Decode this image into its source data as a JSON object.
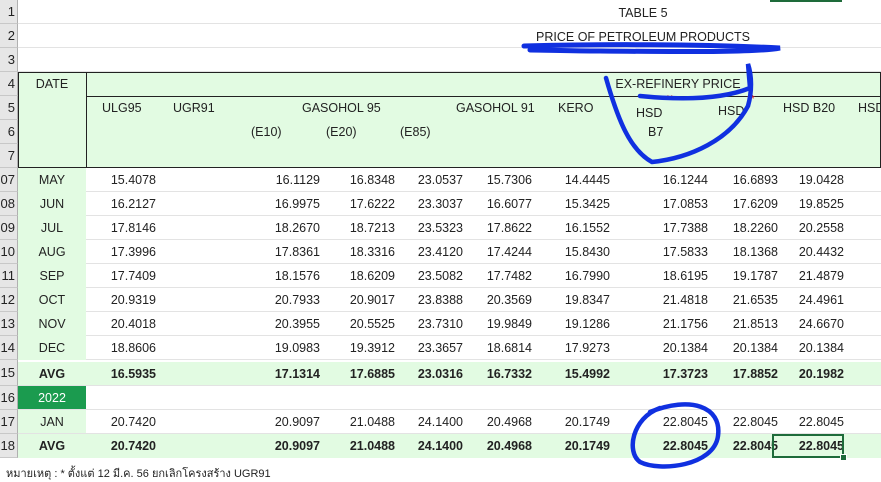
{
  "title": {
    "line1": "TABLE 5",
    "line2": "PRICE OF PETROLEUM PRODUCTS"
  },
  "row_numbers": [
    "1",
    "2",
    "3",
    "4",
    "5",
    "6",
    "7",
    "07",
    "08",
    "09",
    "10",
    "11",
    "12",
    "13",
    "14",
    "15",
    "16",
    "17",
    "18"
  ],
  "header": {
    "date": "DATE",
    "ex_refinery": "EX-REFINERY PRICE",
    "ulg95": "ULG95",
    "ugr91": "UGR91",
    "gasohol95": "GASOHOL 95",
    "e10": "(E10)",
    "e20": "(E20)",
    "e85": "(E85)",
    "gasohol91": "GASOHOL 91",
    "kero": "KERO",
    "hsd": "HSD",
    "b7": "B7",
    "hsd2": "HSD",
    "hsdb20": "HSD B20",
    "hsd_cut": "HSD",
    "marks": "**"
  },
  "rows": [
    {
      "label": "MAY",
      "v": [
        "15.4078",
        "16.1129",
        "16.8348",
        "23.0537",
        "15.7306",
        "14.4445",
        "16.1244",
        "16.6893",
        "19.0428"
      ]
    },
    {
      "label": "JUN",
      "v": [
        "16.2127",
        "16.9975",
        "17.6222",
        "23.3037",
        "16.6077",
        "15.3425",
        "17.0853",
        "17.6209",
        "19.8525"
      ]
    },
    {
      "label": "JUL",
      "v": [
        "17.8146",
        "18.2670",
        "18.7213",
        "23.5323",
        "17.8622",
        "16.1552",
        "17.7388",
        "18.2260",
        "20.2558"
      ]
    },
    {
      "label": "AUG",
      "v": [
        "17.3996",
        "17.8361",
        "18.3316",
        "23.4120",
        "17.4244",
        "15.8430",
        "17.5833",
        "18.1368",
        "20.4432"
      ]
    },
    {
      "label": "SEP",
      "v": [
        "17.7409",
        "18.1576",
        "18.6209",
        "23.5082",
        "17.7482",
        "16.7990",
        "18.6195",
        "19.1787",
        "21.4879"
      ]
    },
    {
      "label": "OCT",
      "v": [
        "20.9319",
        "20.7933",
        "20.9017",
        "23.8388",
        "20.3569",
        "19.8347",
        "21.4818",
        "21.6535",
        "24.4961"
      ]
    },
    {
      "label": "NOV",
      "v": [
        "20.4018",
        "20.3955",
        "20.5525",
        "23.7310",
        "19.9849",
        "19.1286",
        "21.1756",
        "21.8513",
        "24.6670"
      ]
    },
    {
      "label": "DEC",
      "v": [
        "18.8606",
        "19.0983",
        "19.3912",
        "23.3657",
        "18.6814",
        "17.9273",
        "20.1384",
        "20.1384",
        "20.1384"
      ]
    }
  ],
  "avg_row": {
    "label": "AVG",
    "v": [
      "16.5935",
      "17.1314",
      "17.6885",
      "23.0316",
      "16.7332",
      "15.4992",
      "17.3723",
      "17.8852",
      "20.1982"
    ]
  },
  "year": "2022",
  "jan_row": {
    "label": "JAN",
    "v": [
      "20.7420",
      "20.9097",
      "21.0488",
      "24.1400",
      "20.4968",
      "20.1749",
      "22.8045",
      "22.8045",
      "22.8045"
    ]
  },
  "avg2_row": {
    "label": "AVG",
    "v": [
      "20.7420",
      "20.9097",
      "21.0488",
      "24.1400",
      "20.4968",
      "20.1749",
      "22.8045",
      "22.8045",
      "22.8045"
    ]
  },
  "footnote": "หมายเหตุ : * ตั้งแต่ 12 มี.ค. 56 ยกเลิกโครงสร้าง UGR91",
  "colors": {
    "band": "#e2fbe2",
    "year_fill": "#1b9b4f",
    "ink": "#1030e0",
    "selection": "#1e6b3a"
  }
}
